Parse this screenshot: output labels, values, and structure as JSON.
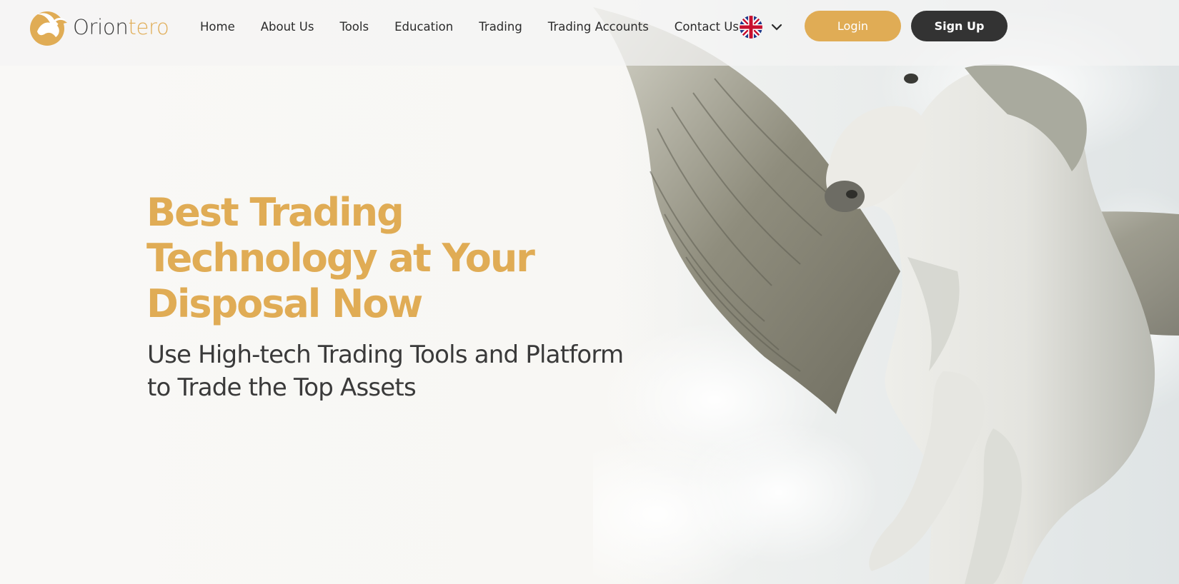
{
  "brand": {
    "name_part1": "Orion",
    "name_part2": "tero",
    "accent_color": "#e0ac55",
    "dark_color": "#333333"
  },
  "nav": {
    "items": [
      {
        "label": "Home"
      },
      {
        "label": "About Us"
      },
      {
        "label": "Tools"
      },
      {
        "label": "Education"
      },
      {
        "label": "Trading"
      },
      {
        "label": "Trading Accounts"
      },
      {
        "label": "Contact Us"
      }
    ]
  },
  "language": {
    "flag_icon": "uk-flag-icon",
    "dropdown_icon": "chevron-down-icon"
  },
  "auth": {
    "login_label": "Login",
    "signup_label": "Sign Up"
  },
  "hero": {
    "title_line1": "Best Trading",
    "title_line2": "Technology at Your",
    "title_line3": "Disposal Now",
    "subtitle_line1": "Use High-tech Trading Tools and Platform",
    "subtitle_line2": "to Trade the Top Assets",
    "image": "winged-horse-pegasus-image"
  }
}
